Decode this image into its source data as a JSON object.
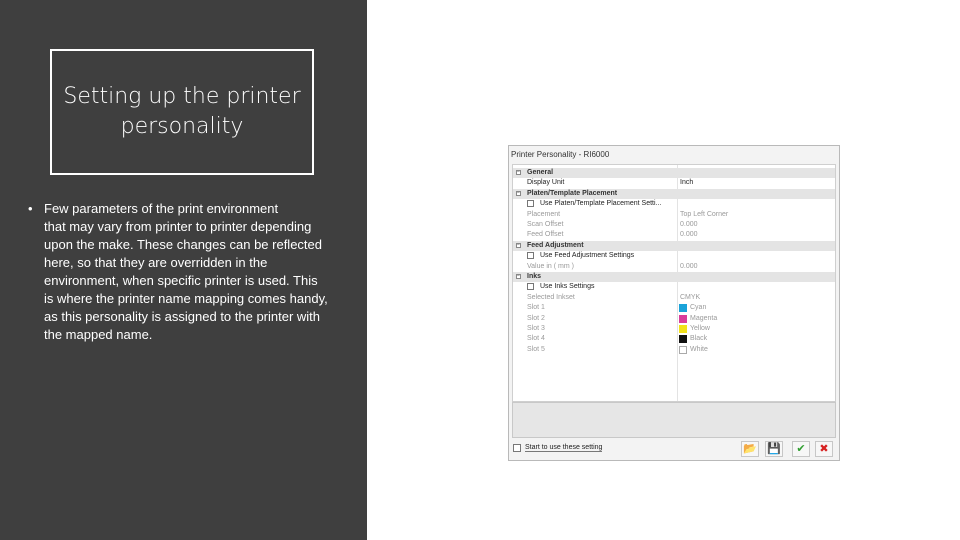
{
  "slide": {
    "title": "Setting up the printer personality",
    "bullet_symbol": "•",
    "bullet_first_line": "Few parameters of the print environment",
    "bullet_rest": "that may vary from printer to printer depending upon the make. These changes can be reflected here, so that they are overridden in the environment, when specific printer is used.  This is where the printer name mapping comes handy, as this personality is assigned to the printer with the mapped name."
  },
  "dialog": {
    "title": "Printer Personality - RI6000",
    "rows": [
      {
        "kind": "cat",
        "label": "General"
      },
      {
        "kind": "prop",
        "key": "Display Unit",
        "value": "Inch"
      },
      {
        "kind": "cat",
        "label": "Platen/Template Placement"
      },
      {
        "kind": "check",
        "label": "Use Platen/Template Placement Setti..."
      },
      {
        "kind": "prop",
        "key": "Placement",
        "value": "Top Left Corner",
        "dim": true
      },
      {
        "kind": "prop",
        "key": "Scan Offset",
        "value": "0.000",
        "dim": true
      },
      {
        "kind": "prop",
        "key": "Feed Offset",
        "value": "0.000",
        "dim": true
      },
      {
        "kind": "cat",
        "label": "Feed Adjustment"
      },
      {
        "kind": "check",
        "label": "Use Feed Adjustment Settings"
      },
      {
        "kind": "prop",
        "key": "Value in ( mm )",
        "value": "0.000",
        "dim": true
      },
      {
        "kind": "cat",
        "label": "Inks"
      },
      {
        "kind": "check",
        "label": "Use Inks Settings"
      },
      {
        "kind": "prop",
        "key": "Selected Inkset",
        "value": "CMYK",
        "dim": true
      },
      {
        "kind": "ink",
        "key": "Slot 1",
        "value": "Cyan",
        "color": "#1aa3d9"
      },
      {
        "kind": "ink",
        "key": "Slot 2",
        "value": "Magenta",
        "color": "#d93d9b"
      },
      {
        "kind": "ink",
        "key": "Slot 3",
        "value": "Yellow",
        "color": "#f2e21b"
      },
      {
        "kind": "ink",
        "key": "Slot 4",
        "value": "Black",
        "color": "#111111"
      },
      {
        "kind": "ink",
        "key": "Slot 5",
        "value": "White",
        "color": "#ffffff"
      }
    ],
    "start_label": "Start to use these setting",
    "buttons": [
      {
        "name": "open-folder-button",
        "icon": "folder-open-icon",
        "glyph": "📂",
        "color": "#c98a1b"
      },
      {
        "name": "save-button",
        "icon": "floppy-disk-icon",
        "glyph": "💾",
        "color": "#2a4d8f"
      },
      {
        "name": "ok-button",
        "icon": "checkmark-icon",
        "glyph": "✔",
        "color": "#2f9e2f"
      },
      {
        "name": "cancel-button",
        "icon": "close-icon",
        "glyph": "✖",
        "color": "#d62020"
      }
    ]
  }
}
